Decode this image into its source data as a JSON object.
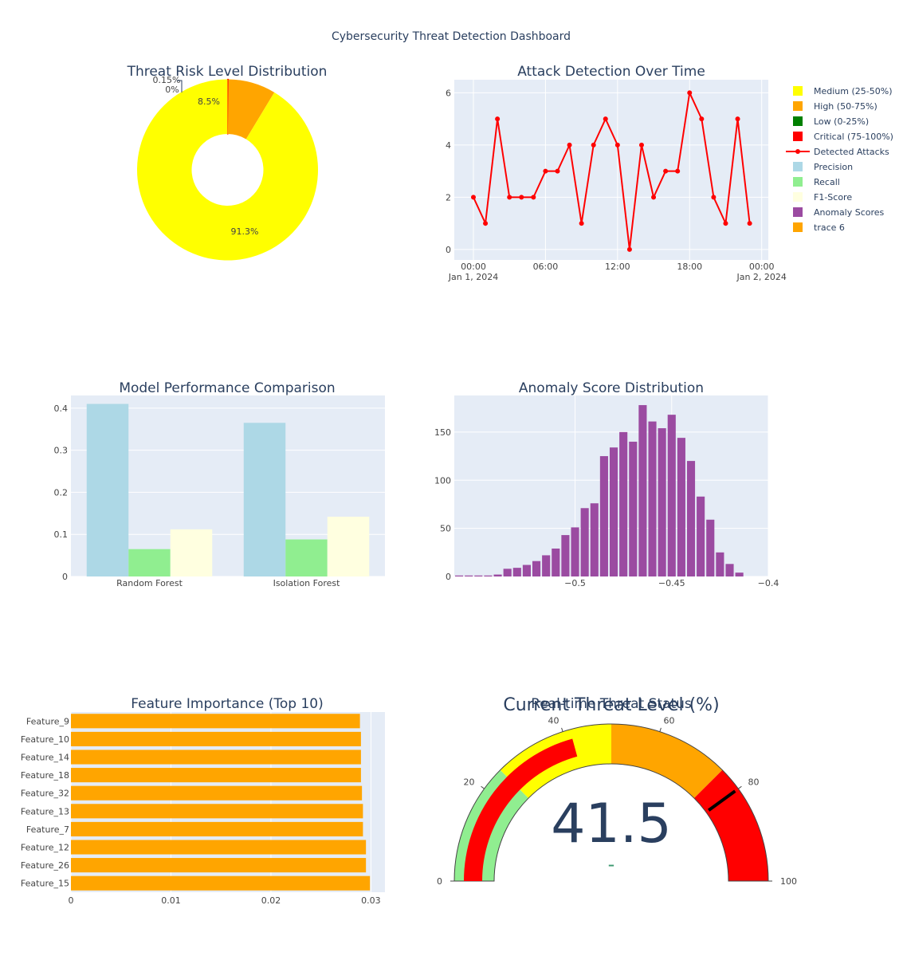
{
  "dashboard_title": "Cybersecurity Threat Detection Dashboard",
  "legend": {
    "items": [
      {
        "label": "Medium (25-50%)",
        "color": "#ffff00",
        "kind": "square"
      },
      {
        "label": "High (50-75%)",
        "color": "#ffa500",
        "kind": "square"
      },
      {
        "label": "Low (0-25%)",
        "color": "#008000",
        "kind": "square"
      },
      {
        "label": "Critical (75-100%)",
        "color": "#ff0000",
        "kind": "square"
      },
      {
        "label": "Detected Attacks",
        "color": "#ff0000",
        "kind": "line"
      },
      {
        "label": "Precision",
        "color": "#add8e6",
        "kind": "square"
      },
      {
        "label": "Recall",
        "color": "#90ee90",
        "kind": "square"
      },
      {
        "label": "F1-Score",
        "color": "#ffffe0",
        "kind": "square"
      },
      {
        "label": "Anomaly Scores",
        "color": "#9b4ba1",
        "kind": "square"
      },
      {
        "label": "trace 6",
        "color": "#ffa500",
        "kind": "square"
      }
    ]
  },
  "chart_data": [
    {
      "id": "pie",
      "type": "pie",
      "title": "Threat Risk Level Distribution",
      "hole": true,
      "slices": [
        {
          "label": "Low (0-25%)",
          "value": 0.0,
          "text": "0%",
          "color": "#008000"
        },
        {
          "label": "Critical (75-100%)",
          "value": 0.15,
          "text": "0.15%",
          "color": "#ff0000"
        },
        {
          "label": "High (50-75%)",
          "value": 8.5,
          "text": "8.5%",
          "color": "#ffa500"
        },
        {
          "label": "Medium (25-50%)",
          "value": 91.3,
          "text": "91.3%",
          "color": "#ffff00"
        }
      ]
    },
    {
      "id": "line",
      "type": "line",
      "title": "Attack Detection Over Time",
      "series": [
        {
          "name": "Detected Attacks",
          "color": "#ff0000"
        }
      ],
      "x": [
        "2024-01-01 00:00",
        "2024-01-01 01:00",
        "2024-01-01 02:00",
        "2024-01-01 03:00",
        "2024-01-01 04:00",
        "2024-01-01 05:00",
        "2024-01-01 06:00",
        "2024-01-01 07:00",
        "2024-01-01 08:00",
        "2024-01-01 09:00",
        "2024-01-01 10:00",
        "2024-01-01 11:00",
        "2024-01-01 12:00",
        "2024-01-01 13:00",
        "2024-01-01 14:00",
        "2024-01-01 15:00",
        "2024-01-01 16:00",
        "2024-01-01 17:00",
        "2024-01-01 18:00",
        "2024-01-01 19:00",
        "2024-01-01 20:00",
        "2024-01-01 21:00",
        "2024-01-01 22:00",
        "2024-01-01 23:00"
      ],
      "y": [
        2,
        1,
        5,
        2,
        2,
        2,
        3,
        3,
        4,
        1,
        4,
        5,
        4,
        0,
        4,
        2,
        3,
        3,
        6,
        5,
        2,
        1,
        5,
        1
      ],
      "xticks": [
        {
          "line1": "00:00",
          "line2": "Jan 1, 2024"
        },
        {
          "line1": "06:00",
          "line2": ""
        },
        {
          "line1": "12:00",
          "line2": ""
        },
        {
          "line1": "18:00",
          "line2": ""
        },
        {
          "line1": "00:00",
          "line2": "Jan 2, 2024"
        }
      ],
      "yticks": [
        "0",
        "2",
        "4",
        "6"
      ],
      "ylim": [
        -0.4,
        6.5
      ]
    },
    {
      "id": "bars",
      "type": "bar",
      "title": "Model Performance Comparison",
      "categories": [
        "Random Forest",
        "Isolation Forest"
      ],
      "series": [
        {
          "name": "Precision",
          "color": "#add8e6",
          "values": [
            0.41,
            0.365
          ]
        },
        {
          "name": "Recall",
          "color": "#90ee90",
          "values": [
            0.065,
            0.088
          ]
        },
        {
          "name": "F1-Score",
          "color": "#ffffe0",
          "values": [
            0.112,
            0.142
          ]
        }
      ],
      "yticks": [
        "0",
        "0.1",
        "0.2",
        "0.3",
        "0.4"
      ],
      "ylim": [
        0,
        0.43
      ]
    },
    {
      "id": "hist",
      "type": "bar",
      "title": "Anomaly Score Distribution",
      "series": [
        {
          "name": "Anomaly Scores",
          "color": "#9b4ba1"
        }
      ],
      "bin_start": -0.5625,
      "bin_width": 0.005,
      "counts": [
        1,
        1,
        1,
        1,
        2,
        8,
        9,
        12,
        16,
        22,
        29,
        43,
        51,
        71,
        76,
        125,
        134,
        150,
        140,
        178,
        161,
        154,
        168,
        144,
        120,
        83,
        59,
        25,
        13,
        4
      ],
      "xticks": [
        {
          "value": -0.5,
          "label": "−0.5"
        },
        {
          "value": -0.45,
          "label": "−0.45"
        },
        {
          "value": -0.4,
          "label": "−0.4"
        }
      ],
      "yticks": [
        "0",
        "50",
        "100",
        "150"
      ],
      "xlim": [
        -0.5625,
        -0.4
      ],
      "ylim": [
        0,
        188
      ]
    },
    {
      "id": "hbar",
      "type": "bar",
      "orientation": "horizontal",
      "title": "Feature Importance (Top 10)",
      "series": [
        {
          "name": "trace 6",
          "color": "#ffa500"
        }
      ],
      "categories": [
        "Feature_9",
        "Feature_10",
        "Feature_14",
        "Feature_18",
        "Feature_32",
        "Feature_13",
        "Feature_7",
        "Feature_12",
        "Feature_26",
        "Feature_15"
      ],
      "values": [
        0.0289,
        0.029,
        0.029,
        0.029,
        0.0291,
        0.0292,
        0.0292,
        0.0295,
        0.0295,
        0.0299
      ],
      "xticks": [
        "0",
        "0.01",
        "0.02",
        "0.03"
      ],
      "xlim": [
        0,
        0.0314
      ]
    },
    {
      "id": "gauge",
      "type": "gauge",
      "title": "Real-time Threat Status",
      "gauge_title": "Current Threat Level (%)",
      "value": 41.5,
      "value_text": "41.5",
      "delta_text": "-",
      "range": [
        0,
        100
      ],
      "ticks": [
        "0",
        "20",
        "40",
        "60",
        "80",
        "100"
      ],
      "steps": [
        {
          "range": [
            0,
            25
          ],
          "color": "#90ee90"
        },
        {
          "range": [
            25,
            50
          ],
          "color": "#ffff00"
        },
        {
          "range": [
            50,
            75
          ],
          "color": "#ffa500"
        },
        {
          "range": [
            75,
            100
          ],
          "color": "#ff0000"
        }
      ],
      "bar_color": "#ff0000",
      "threshold": 80
    }
  ]
}
